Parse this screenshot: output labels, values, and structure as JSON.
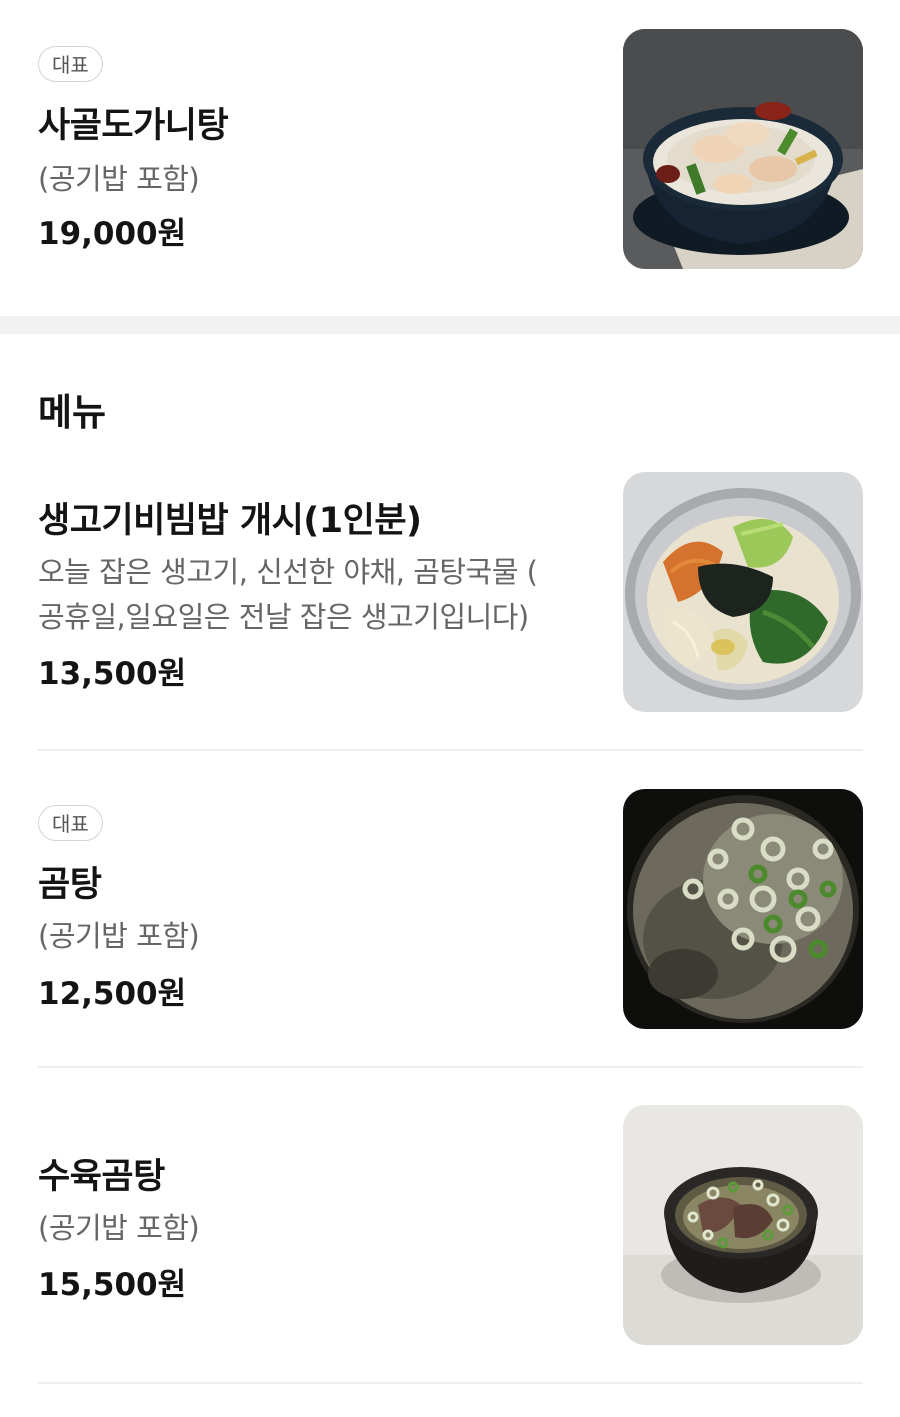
{
  "featured": {
    "badge": "대표",
    "name": "사골도가니탕",
    "description": "(공기밥 포함)",
    "price": "19,000원",
    "image_icon": "food-photo-dogani-tang"
  },
  "menu_section": {
    "title": "메뉴",
    "items": [
      {
        "badge": "",
        "name": "생고기비빔밥 개시(1인분)",
        "description_line1": "오늘 잡은 생고기, 신선한 야채, 곰탕국물 (",
        "description_line2": "공휴일,일요일은 전날 잡은 생고기입니다)",
        "price": "13,500원",
        "image_icon": "food-photo-bibimbap"
      },
      {
        "badge": "대표",
        "name": "곰탕",
        "description": "(공기밥 포함)",
        "price": "12,500원",
        "image_icon": "food-photo-gomtang"
      },
      {
        "badge": "",
        "name": "수육곰탕",
        "description": "(공기밥 포함)",
        "price": "15,500원",
        "image_icon": "food-photo-suyuk-gomtang"
      }
    ]
  },
  "colors": {
    "text_primary": "#141414",
    "text_secondary": "#666666",
    "badge_border": "#d4d4d4",
    "section_gap": "#f1f1f1",
    "divider": "#efefef"
  }
}
